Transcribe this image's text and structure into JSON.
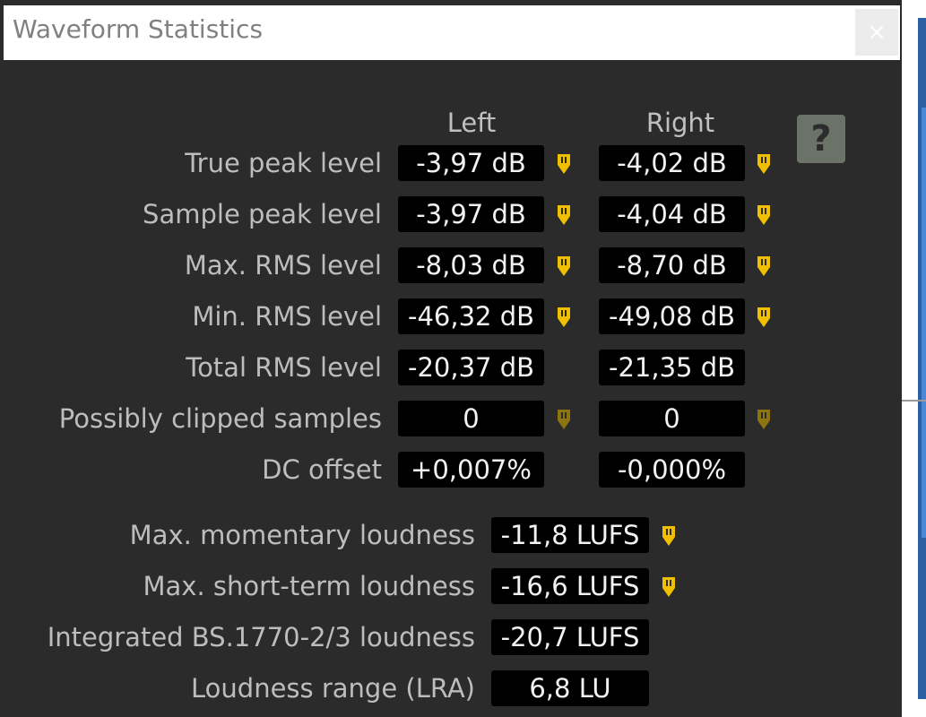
{
  "window": {
    "title": "Waveform Statistics",
    "close_glyph": "×"
  },
  "help": {
    "glyph": "?"
  },
  "columns": {
    "left": "Left",
    "right": "Right"
  },
  "channel_rows": [
    {
      "label": "True peak level",
      "left": "-3,97 dB",
      "right": "-4,02 dB",
      "markers": true,
      "dim": false
    },
    {
      "label": "Sample peak level",
      "left": "-3,97 dB",
      "right": "-4,04 dB",
      "markers": true,
      "dim": false
    },
    {
      "label": "Max. RMS level",
      "left": "-8,03 dB",
      "right": "-8,70 dB",
      "markers": true,
      "dim": false
    },
    {
      "label": "Min. RMS level",
      "left": "-46,32 dB",
      "right": "-49,08 dB",
      "markers": true,
      "dim": false
    },
    {
      "label": "Total RMS level",
      "left": "-20,37 dB",
      "right": "-21,35 dB",
      "markers": false,
      "dim": false
    },
    {
      "label": "Possibly clipped samples",
      "left": "0",
      "right": "0",
      "markers": true,
      "dim": true
    },
    {
      "label": "DC offset",
      "left": "+0,007%",
      "right": "-0,000%",
      "markers": false,
      "dim": false
    }
  ],
  "loudness_rows": [
    {
      "label": "Max. momentary loudness",
      "value": "-11,8 LUFS",
      "marker": true
    },
    {
      "label": "Max. short-term loudness",
      "value": "-16,6 LUFS",
      "marker": true
    },
    {
      "label": "Integrated BS.1770-2/3 loudness",
      "value": "-20,7 LUFS",
      "marker": false
    },
    {
      "label": "Loudness range (LRA)",
      "value": "6,8 LU",
      "marker": false
    }
  ],
  "colors": {
    "marker": "#f0c000",
    "marker_dim": "#8c7410",
    "value_bg": "#000000",
    "label": "#bdbdbd"
  },
  "icons": {
    "marker": "marker-pin-icon",
    "help": "help-icon",
    "close": "close-icon"
  }
}
